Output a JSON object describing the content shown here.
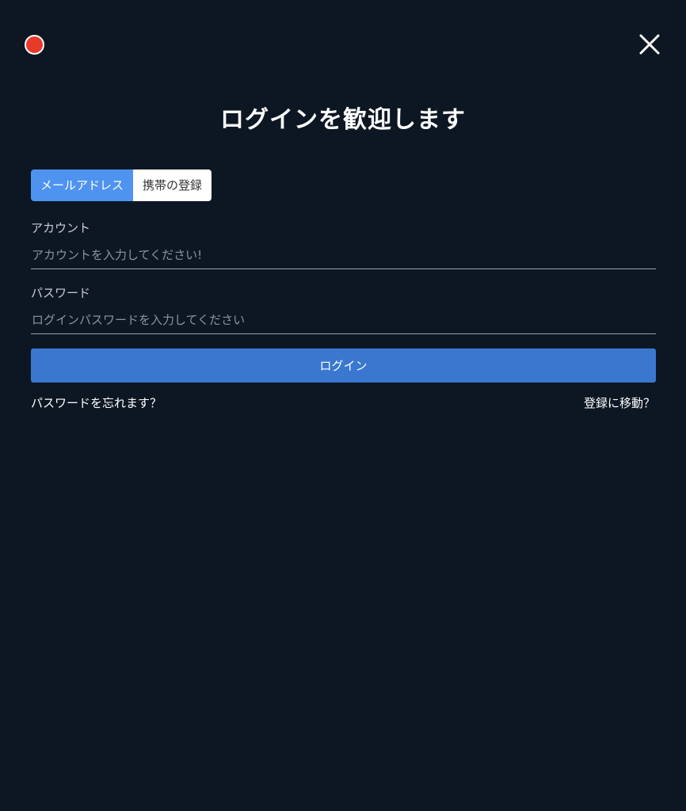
{
  "header": {
    "record_icon": "record-dot-icon",
    "record_color": "#e8392b",
    "close_icon": "close-icon"
  },
  "title": "ログインを歓迎します",
  "tabs": [
    {
      "label": "メールアドレス",
      "active": true
    },
    {
      "label": "携帯の登録",
      "active": false
    }
  ],
  "account": {
    "label": "アカウント",
    "placeholder": "アカウントを入力してください!",
    "value": ""
  },
  "password": {
    "label": "パスワード",
    "placeholder": "ログインパスワードを入力してください",
    "value": ""
  },
  "login_button": "ログイン",
  "links": {
    "forgot": "パスワードを忘れます？",
    "register": "登録に移動？"
  },
  "colors": {
    "background": "#0d1723",
    "accent": "#3a78d0",
    "active_tab": "#4f93f0"
  }
}
